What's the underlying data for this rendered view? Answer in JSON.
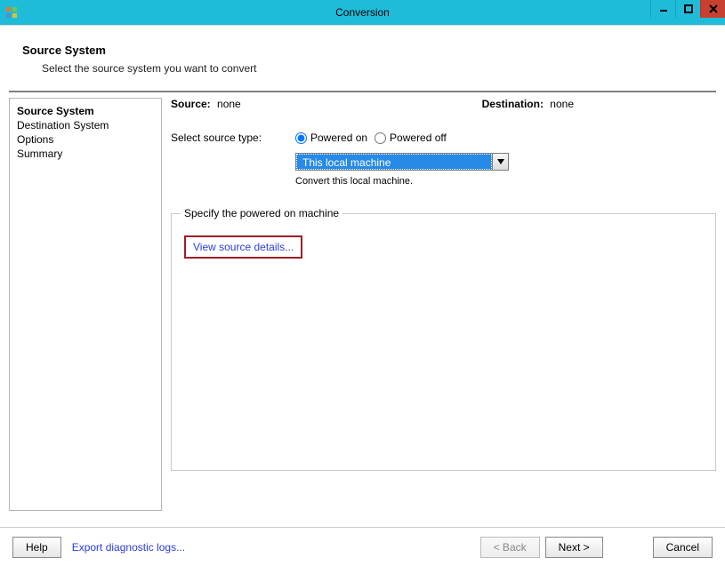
{
  "window": {
    "title": "Conversion"
  },
  "header": {
    "title": "Source System",
    "subtitle": "Select the source system you want to convert"
  },
  "sidebar": {
    "items": [
      {
        "label": "Source System",
        "active": true
      },
      {
        "label": "Destination System",
        "active": false
      },
      {
        "label": "Options",
        "active": false
      },
      {
        "label": "Summary",
        "active": false
      }
    ]
  },
  "main": {
    "source_label": "Source:",
    "source_value": "none",
    "destination_label": "Destination:",
    "destination_value": "none",
    "select_source_type_label": "Select source type:",
    "radio_powered_on": "Powered on",
    "radio_powered_off": "Powered off",
    "dropdown_selected": "This local machine",
    "dropdown_helper": "Convert this local machine.",
    "groupbox_legend": "Specify the powered on machine",
    "view_source_details": "View source details..."
  },
  "footer": {
    "help": "Help",
    "export_logs": "Export diagnostic logs...",
    "back": "< Back",
    "next": "Next >",
    "cancel": "Cancel"
  }
}
